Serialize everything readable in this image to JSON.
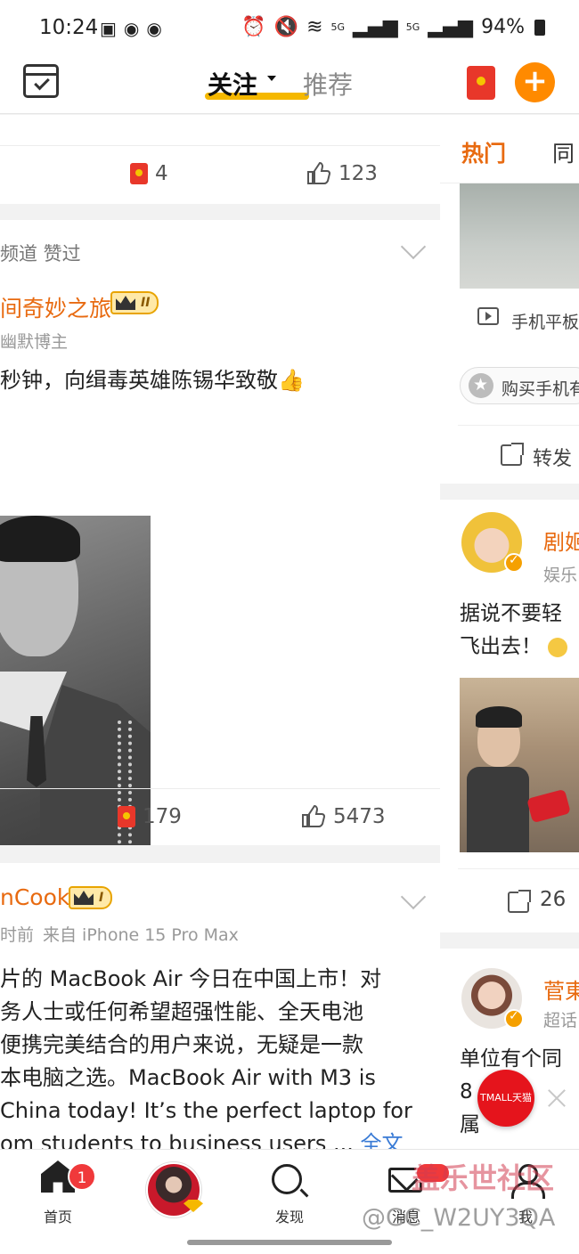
{
  "status_bar": {
    "time": "10:24",
    "battery": "94%",
    "signal_1": "5G",
    "signal_2": "5G",
    "icons": [
      "gallery-icon",
      "weibo-icon",
      "weibo-icon",
      "alarm-icon",
      "mute-icon",
      "wifi-icon",
      "signal-icon",
      "battery-icon"
    ]
  },
  "header": {
    "tab_follow": "关注",
    "tab_recommend": "推荐",
    "accent_color": "#f5b800",
    "plus_color": "#ff8a00"
  },
  "feed": {
    "top_actions": {
      "redpack_count": "4",
      "like_count": "123"
    },
    "post1": {
      "label": "频道 赞过",
      "user_name": "间奇妙之旅",
      "level": "II",
      "user_sub": "幽默博主",
      "text": "秒钟，向缉毒英雄陈锡华致敬👍",
      "redpack_count": "179",
      "like_count": "5473"
    },
    "post2": {
      "user_name": "nCook",
      "level": "I",
      "meta_time": "时前",
      "meta_source": "来自 iPhone 15 Pro Max",
      "lines": [
        "片的 MacBook Air 今日在中国上市！对",
        "务人士或任何希望超强性能、全天电池",
        "便携完美结合的用户来说，无疑是一款",
        "本电脑之选。MacBook Air with M3 is",
        " China today! It’s the perfect laptop for",
        "om students to business users ... "
      ],
      "more_link": "全文"
    }
  },
  "side": {
    "tab_hot": "热门",
    "tab_same": "同",
    "video_label": "手机平板",
    "chip_label": "购买手机有",
    "forward_label": "转发",
    "user1_name": "剧姬",
    "user1_sub": "娱乐",
    "user1_post_line1": "据说不要轻",
    "user1_post_line2": "飞出去！",
    "forward_count": "26",
    "user2_name": "菅東",
    "user2_sub": "超话",
    "user2_line1": "单位有个同",
    "user2_line2": "8",
    "user2_line3": "属"
  },
  "tmall": {
    "label": "TMALL天猫"
  },
  "bottom_nav": {
    "home_label": "首页",
    "home_badge": "1",
    "discover_label": "发现",
    "message_label": "消息",
    "me_label": "我"
  },
  "watermark": {
    "line1": "盖乐世社区",
    "line2": "@GC_W2UY3QA"
  }
}
